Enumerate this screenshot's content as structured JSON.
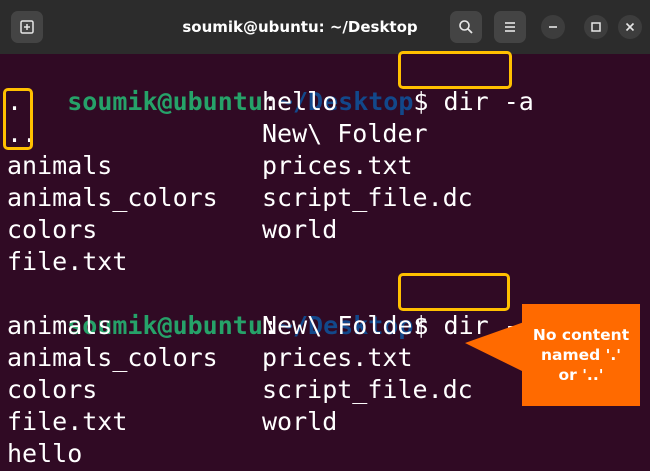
{
  "window": {
    "title": "soumik@ubuntu: ~/Desktop",
    "icons": {
      "new_tab": "new-tab-icon",
      "search": "search-icon",
      "menu": "hamburger-menu-icon",
      "minimize": "minimize-icon",
      "maximize": "maximize-icon",
      "close": "close-icon"
    }
  },
  "colors": {
    "terminal_bg": "#300a24",
    "prompt_user": "#26a269",
    "prompt_path": "#12488b",
    "highlight_border": "#ffc000",
    "callout_bg": "#ff6a00"
  },
  "terminal": {
    "prompt1": {
      "user": "soumik@ubuntu",
      "colon": ":",
      "path": "~/Desktop",
      "dollar": "$",
      "command": "dir -a"
    },
    "output1": [
      [
        ".",
        "hello"
      ],
      [
        "..",
        "New\\ Folder"
      ],
      [
        "animals",
        "prices.txt"
      ],
      [
        "animals_colors",
        "script_file.dc"
      ],
      [
        "colors",
        "world"
      ],
      [
        "file.txt",
        ""
      ]
    ],
    "prompt2": {
      "user": "soumik@ubuntu",
      "colon": ":",
      "path": "~/Desktop",
      "dollar": "$",
      "command": "dir -A"
    },
    "output2": [
      [
        "animals",
        "New\\ Folder"
      ],
      [
        "animals_colors",
        "prices.txt"
      ],
      [
        "colors",
        "script_file.dc"
      ],
      [
        "file.txt",
        "world"
      ],
      [
        "hello",
        ""
      ]
    ]
  },
  "annotation": {
    "callout_text": "No content\nnamed '.'\nor '..'"
  }
}
